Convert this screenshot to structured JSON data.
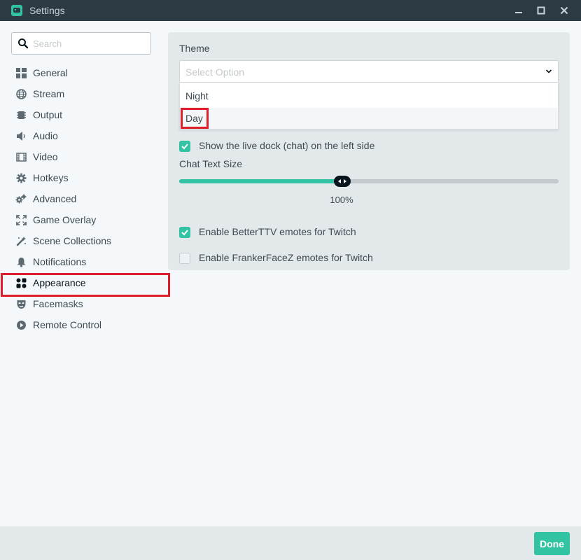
{
  "window": {
    "title": "Settings",
    "controls": [
      "minimize",
      "maximize",
      "close"
    ]
  },
  "search": {
    "placeholder": "Search",
    "value": ""
  },
  "sidebar": {
    "items": [
      {
        "label": "General",
        "icon": "grid-icon"
      },
      {
        "label": "Stream",
        "icon": "globe-icon"
      },
      {
        "label": "Output",
        "icon": "chip-icon"
      },
      {
        "label": "Audio",
        "icon": "speaker-icon"
      },
      {
        "label": "Video",
        "icon": "film-icon"
      },
      {
        "label": "Hotkeys",
        "icon": "gear-icon"
      },
      {
        "label": "Advanced",
        "icon": "gears-icon"
      },
      {
        "label": "Game Overlay",
        "icon": "expand-icon"
      },
      {
        "label": "Scene Collections",
        "icon": "magic-wand-icon"
      },
      {
        "label": "Notifications",
        "icon": "bell-icon"
      },
      {
        "label": "Appearance",
        "icon": "palette-icon",
        "active": true
      },
      {
        "label": "Facemasks",
        "icon": "mask-icon"
      },
      {
        "label": "Remote Control",
        "icon": "play-circle-icon"
      }
    ]
  },
  "appearance": {
    "theme_label": "Theme",
    "theme_placeholder": "Select Option",
    "theme_options": [
      "Night",
      "Day"
    ],
    "live_dock_label": "Show the live dock (chat) on the left side",
    "live_dock_checked": true,
    "chat_text_size_label": "Chat Text Size",
    "chat_text_size_value": "100%",
    "chat_text_size_fraction": 0.43,
    "bttv_label": "Enable BetterTTV emotes for Twitch",
    "bttv_checked": true,
    "ffz_label": "Enable FrankerFaceZ emotes for Twitch",
    "ffz_checked": false
  },
  "footer": {
    "done_label": "Done"
  },
  "colors": {
    "accent": "#31c3a2",
    "highlight_red": "#dd1f2b",
    "titlebar": "#2c3a43"
  }
}
